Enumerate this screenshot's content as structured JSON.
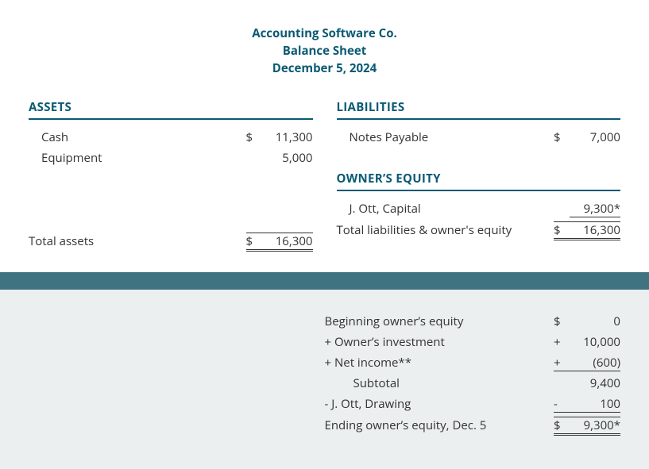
{
  "header": {
    "company": "Accounting Software Co.",
    "title": "Balance Sheet",
    "date": "December 5, 2024"
  },
  "assets": {
    "title": "ASSETS",
    "rows": [
      {
        "label": "Cash",
        "cur": "$",
        "amt": "11,300"
      },
      {
        "label": "Equipment",
        "cur": "",
        "amt": "5,000"
      }
    ],
    "total": {
      "label": "Total assets",
      "cur": "$",
      "amt": "16,300"
    }
  },
  "liabilities": {
    "title": "LIABILITIES",
    "rows": [
      {
        "label": "Notes Payable",
        "cur": "$",
        "amt": "7,000"
      }
    ]
  },
  "equity": {
    "title": "OWNER’S EQUITY",
    "rows": [
      {
        "label": "J. Ott, Capital",
        "cur": "",
        "amt": "9,300*"
      }
    ],
    "total": {
      "label": "Total liabilities & owner's equity",
      "cur": "$",
      "amt": "16,300"
    }
  },
  "calc": {
    "rows": [
      {
        "label": "Beginning owner’s equity",
        "cur": "$",
        "amt": "0",
        "style": ""
      },
      {
        "label": "+ Owner’s investment",
        "cur": "+",
        "amt": "10,000",
        "style": ""
      },
      {
        "label": "+ Net income**",
        "cur": "+",
        "amt": "(600)",
        "style": "single-top-next"
      },
      {
        "label": "Subtotal",
        "cur": "",
        "amt": "9,400",
        "style": "",
        "indent": true
      },
      {
        "label": "- J. Ott, Drawing",
        "cur": "-",
        "amt": "100",
        "style": "single-top-next"
      },
      {
        "label": "Ending owner’s equity, Dec. 5",
        "cur": "$",
        "amt": "9,300*",
        "style": "dbl"
      }
    ]
  }
}
